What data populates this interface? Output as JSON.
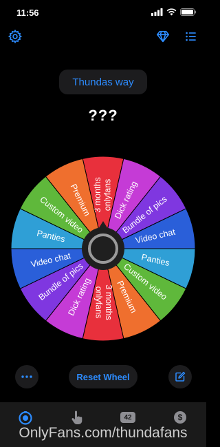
{
  "status_bar": {
    "time": "11:56"
  },
  "header": {
    "settings_icon": "gear-icon",
    "premium_icon": "diamond-icon",
    "list_icon": "list-icon"
  },
  "wheel_title": "Thundas way",
  "result": "???",
  "wheel": {
    "segments": [
      {
        "label": "3 months onlyfans",
        "color": "#e8303c"
      },
      {
        "label": "Dick rating",
        "color": "#c53bd6"
      },
      {
        "label": "Bundle of pics",
        "color": "#7f37e0"
      },
      {
        "label": "Video chat",
        "color": "#2a5fd9"
      },
      {
        "label": "Panties",
        "color": "#2f9fd6"
      },
      {
        "label": "Custom video",
        "color": "#5fb83b"
      },
      {
        "label": "Premium",
        "color": "#ef6f2e"
      },
      {
        "label": "3 months onlyfans",
        "color": "#e8303c"
      },
      {
        "label": "Dick rating",
        "color": "#c53bd6"
      },
      {
        "label": "Bundle of pics",
        "color": "#7f37e0"
      },
      {
        "label": "Video chat",
        "color": "#2a5fd9"
      },
      {
        "label": "Panties",
        "color": "#2f9fd6"
      },
      {
        "label": "Custom video",
        "color": "#5fb83b"
      },
      {
        "label": "Premium",
        "color": "#ef6f2e"
      }
    ]
  },
  "controls": {
    "more_icon": "ellipsis-icon",
    "reset_label": "Reset Wheel",
    "edit_icon": "edit-icon"
  },
  "tab_bar": {
    "tabs": [
      {
        "icon": "wheel-icon",
        "active": true
      },
      {
        "icon": "tap-icon",
        "active": false
      },
      {
        "icon": "counter-badge",
        "label": "42",
        "active": false
      },
      {
        "icon": "dollar-icon",
        "label": "$",
        "active": false
      }
    ]
  },
  "watermark": "OnlyFans.com/thundafans",
  "colors": {
    "accent": "#2d8cff",
    "surface": "#1c1c1e",
    "inactive": "#8e8e93"
  }
}
